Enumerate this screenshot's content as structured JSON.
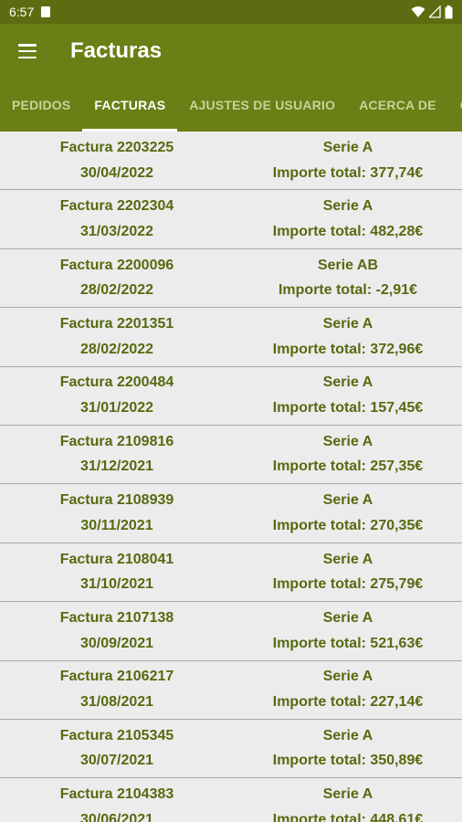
{
  "status": {
    "time": "6:57"
  },
  "appbar": {
    "title": "Facturas"
  },
  "tabs": [
    "PEDIDOS",
    "FACTURAS",
    "AJUSTES DE USUARIO",
    "ACERCA DE",
    "CONTACTO"
  ],
  "invoices": [
    {
      "number": "Factura 2203225",
      "date": "30/04/2022",
      "serie": "Serie A",
      "total": "Importe total: 377,74€"
    },
    {
      "number": "Factura 2202304",
      "date": "31/03/2022",
      "serie": "Serie A",
      "total": "Importe total: 482,28€"
    },
    {
      "number": "Factura 2200096",
      "date": "28/02/2022",
      "serie": "Serie AB",
      "total": "Importe total: -2,91€"
    },
    {
      "number": "Factura 2201351",
      "date": "28/02/2022",
      "serie": "Serie A",
      "total": "Importe total: 372,96€"
    },
    {
      "number": "Factura 2200484",
      "date": "31/01/2022",
      "serie": "Serie A",
      "total": "Importe total: 157,45€"
    },
    {
      "number": "Factura 2109816",
      "date": "31/12/2021",
      "serie": "Serie A",
      "total": "Importe total: 257,35€"
    },
    {
      "number": "Factura 2108939",
      "date": "30/11/2021",
      "serie": "Serie A",
      "total": "Importe total: 270,35€"
    },
    {
      "number": "Factura 2108041",
      "date": "31/10/2021",
      "serie": "Serie A",
      "total": "Importe total: 275,79€"
    },
    {
      "number": "Factura 2107138",
      "date": "30/09/2021",
      "serie": "Serie A",
      "total": "Importe total: 521,63€"
    },
    {
      "number": "Factura 2106217",
      "date": "31/08/2021",
      "serie": "Serie A",
      "total": "Importe total: 227,14€"
    },
    {
      "number": "Factura 2105345",
      "date": "30/07/2021",
      "serie": "Serie A",
      "total": "Importe total: 350,89€"
    },
    {
      "number": "Factura 2104383",
      "date": "30/06/2021",
      "serie": "Serie A",
      "total": "Importe total: 448,61€"
    }
  ]
}
